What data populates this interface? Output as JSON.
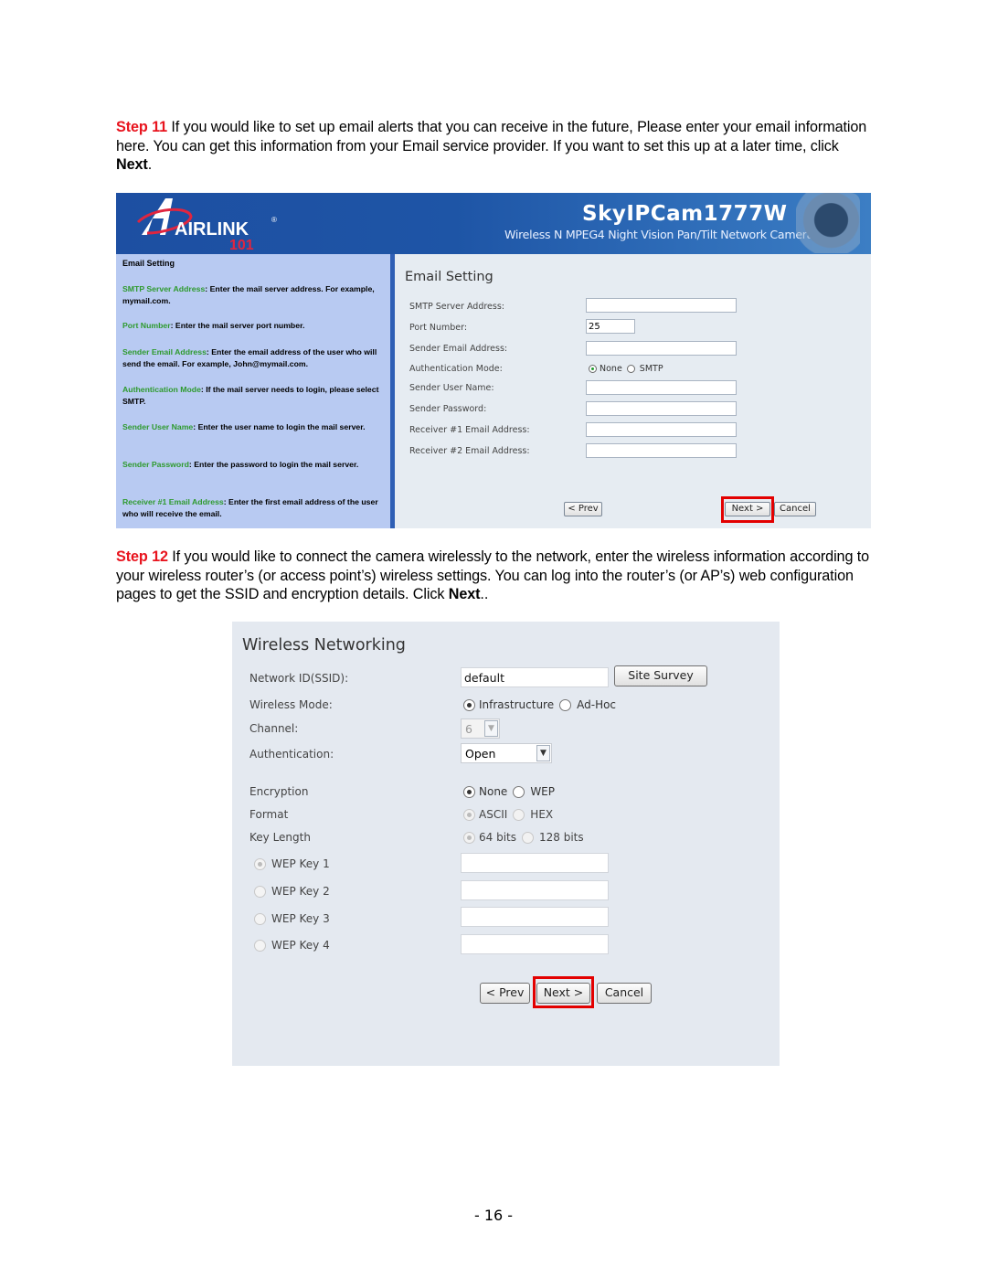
{
  "step11": {
    "label": "Step 11",
    "text": " If you would like to set up email alerts that you can receive in the future, Please enter your email information here.  You can get this information from your Email service provider.  If you want to set this up at a later time, click ",
    "bold": "Next",
    "end": "."
  },
  "email_screen": {
    "banner": {
      "logo_text": "AIRLINK",
      "logo_number": "101",
      "logo_reg": "®",
      "product_title": "SkyIPCam1777W",
      "product_subtitle": "Wireless N MPEG4 Night Vision Pan/Tilt Network Camera"
    },
    "help": {
      "title": "Email Setting",
      "items": [
        {
          "key": "SMTP Server Address",
          "text": ": Enter the mail server address. For example, mymail.com."
        },
        {
          "key": "Port Number",
          "text": ": Enter the mail server port number."
        },
        {
          "key": "Sender Email Address",
          "text": ": Enter the email address of the user who will send the email. For example, John@mymail.com."
        },
        {
          "key": "Authentication Mode",
          "text": ": If the mail server needs to login, please select SMTP."
        },
        {
          "key": "Sender User Name",
          "text": ": Enter the user name to login the mail server."
        },
        {
          "key": "Sender Password",
          "text": ": Enter the password to login the mail server."
        },
        {
          "key": "Receiver #1 Email Address",
          "text": ": Enter the first email address of the user who will receive the email."
        }
      ]
    },
    "form": {
      "title": "Email Setting",
      "fields": [
        {
          "label": "SMTP Server Address:",
          "value": ""
        },
        {
          "label": "Port Number:",
          "value": "25"
        },
        {
          "label": "Sender Email Address:",
          "value": ""
        },
        {
          "label": "Authentication Mode:",
          "options": [
            "None",
            "SMTP"
          ],
          "selected": "None"
        },
        {
          "label": "Sender User Name:",
          "value": ""
        },
        {
          "label": "Sender Password:",
          "value": ""
        },
        {
          "label": "Receiver #1 Email Address:",
          "value": ""
        },
        {
          "label": "Receiver #2 Email Address:",
          "value": ""
        }
      ],
      "buttons": {
        "prev": "< Prev",
        "next": "Next >",
        "cancel": "Cancel"
      }
    }
  },
  "step12": {
    "label": "Step 12",
    "text": " If you would like to connect the camera wirelessly to the network, enter the wireless information according to your wireless router’s (or access point’s) wireless settings. You can log into the router’s (or AP’s) web configuration pages to get the SSID and encryption details. Click ",
    "bold": "Next",
    "end": ".."
  },
  "wireless_screen": {
    "title": "Wireless Networking",
    "ssid": {
      "label": "Network ID(SSID):",
      "value": "default",
      "button": "Site Survey"
    },
    "mode": {
      "label": "Wireless Mode:",
      "options": [
        "Infrastructure",
        "Ad-Hoc"
      ],
      "selected": "Infrastructure"
    },
    "channel": {
      "label": "Channel:",
      "value": "6"
    },
    "authentication": {
      "label": "Authentication:",
      "value": "Open"
    },
    "encryption": {
      "label": "Encryption",
      "options": [
        "None",
        "WEP"
      ],
      "selected": "None"
    },
    "format": {
      "label": "Format",
      "options": [
        "ASCII",
        "HEX"
      ],
      "selected": "ASCII"
    },
    "key_length": {
      "label": "Key Length",
      "options": [
        "64 bits",
        "128 bits"
      ],
      "selected": "64 bits"
    },
    "wep_keys": [
      {
        "label": "WEP Key 1",
        "value": "",
        "selected": true
      },
      {
        "label": "WEP Key 2",
        "value": "",
        "selected": false
      },
      {
        "label": "WEP Key 3",
        "value": "",
        "selected": false
      },
      {
        "label": "WEP Key 4",
        "value": "",
        "selected": false
      }
    ],
    "buttons": {
      "prev": "< Prev",
      "next": "Next >",
      "cancel": "Cancel"
    }
  },
  "page_number": "- 16 -",
  "colors": {
    "step_red": "#e8141e",
    "highlight_red": "#e30000",
    "help_key_green": "#2e9a2e",
    "banner_blue": "#1d4fa2"
  }
}
